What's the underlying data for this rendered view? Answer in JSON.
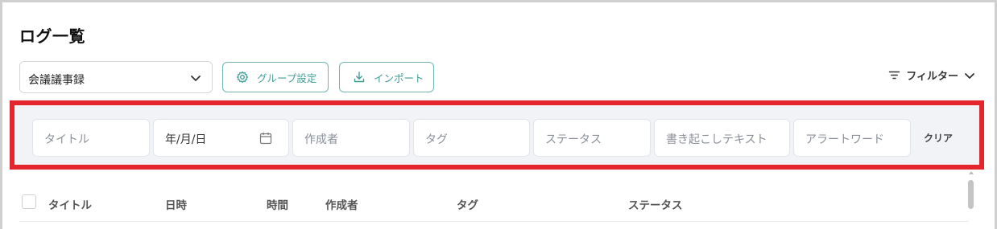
{
  "page": {
    "title": "ログ一覧"
  },
  "toolbar": {
    "group_select_value": "会議議事録",
    "group_settings_label": "グループ設定",
    "import_label": "インポート",
    "filter_label": "フィルター"
  },
  "filters": {
    "title_placeholder": "タイトル",
    "date_placeholder": "年/月/日",
    "author_placeholder": "作成者",
    "tag_placeholder": "タグ",
    "status_placeholder": "ステータス",
    "transcript_placeholder": "書き起こしテキスト",
    "alert_placeholder": "アラートワード",
    "clear_label": "クリア"
  },
  "table": {
    "columns": [
      "タイトル",
      "日時",
      "時間",
      "作成者",
      "タグ",
      "ステータス"
    ]
  },
  "colors": {
    "accent": "#3f9d96",
    "highlight_border": "#e3252c",
    "panel_bg": "#f1f3f7"
  },
  "icons": [
    "chevron-down-icon",
    "gear-icon",
    "download-icon",
    "filter-icon",
    "calendar-icon"
  ]
}
